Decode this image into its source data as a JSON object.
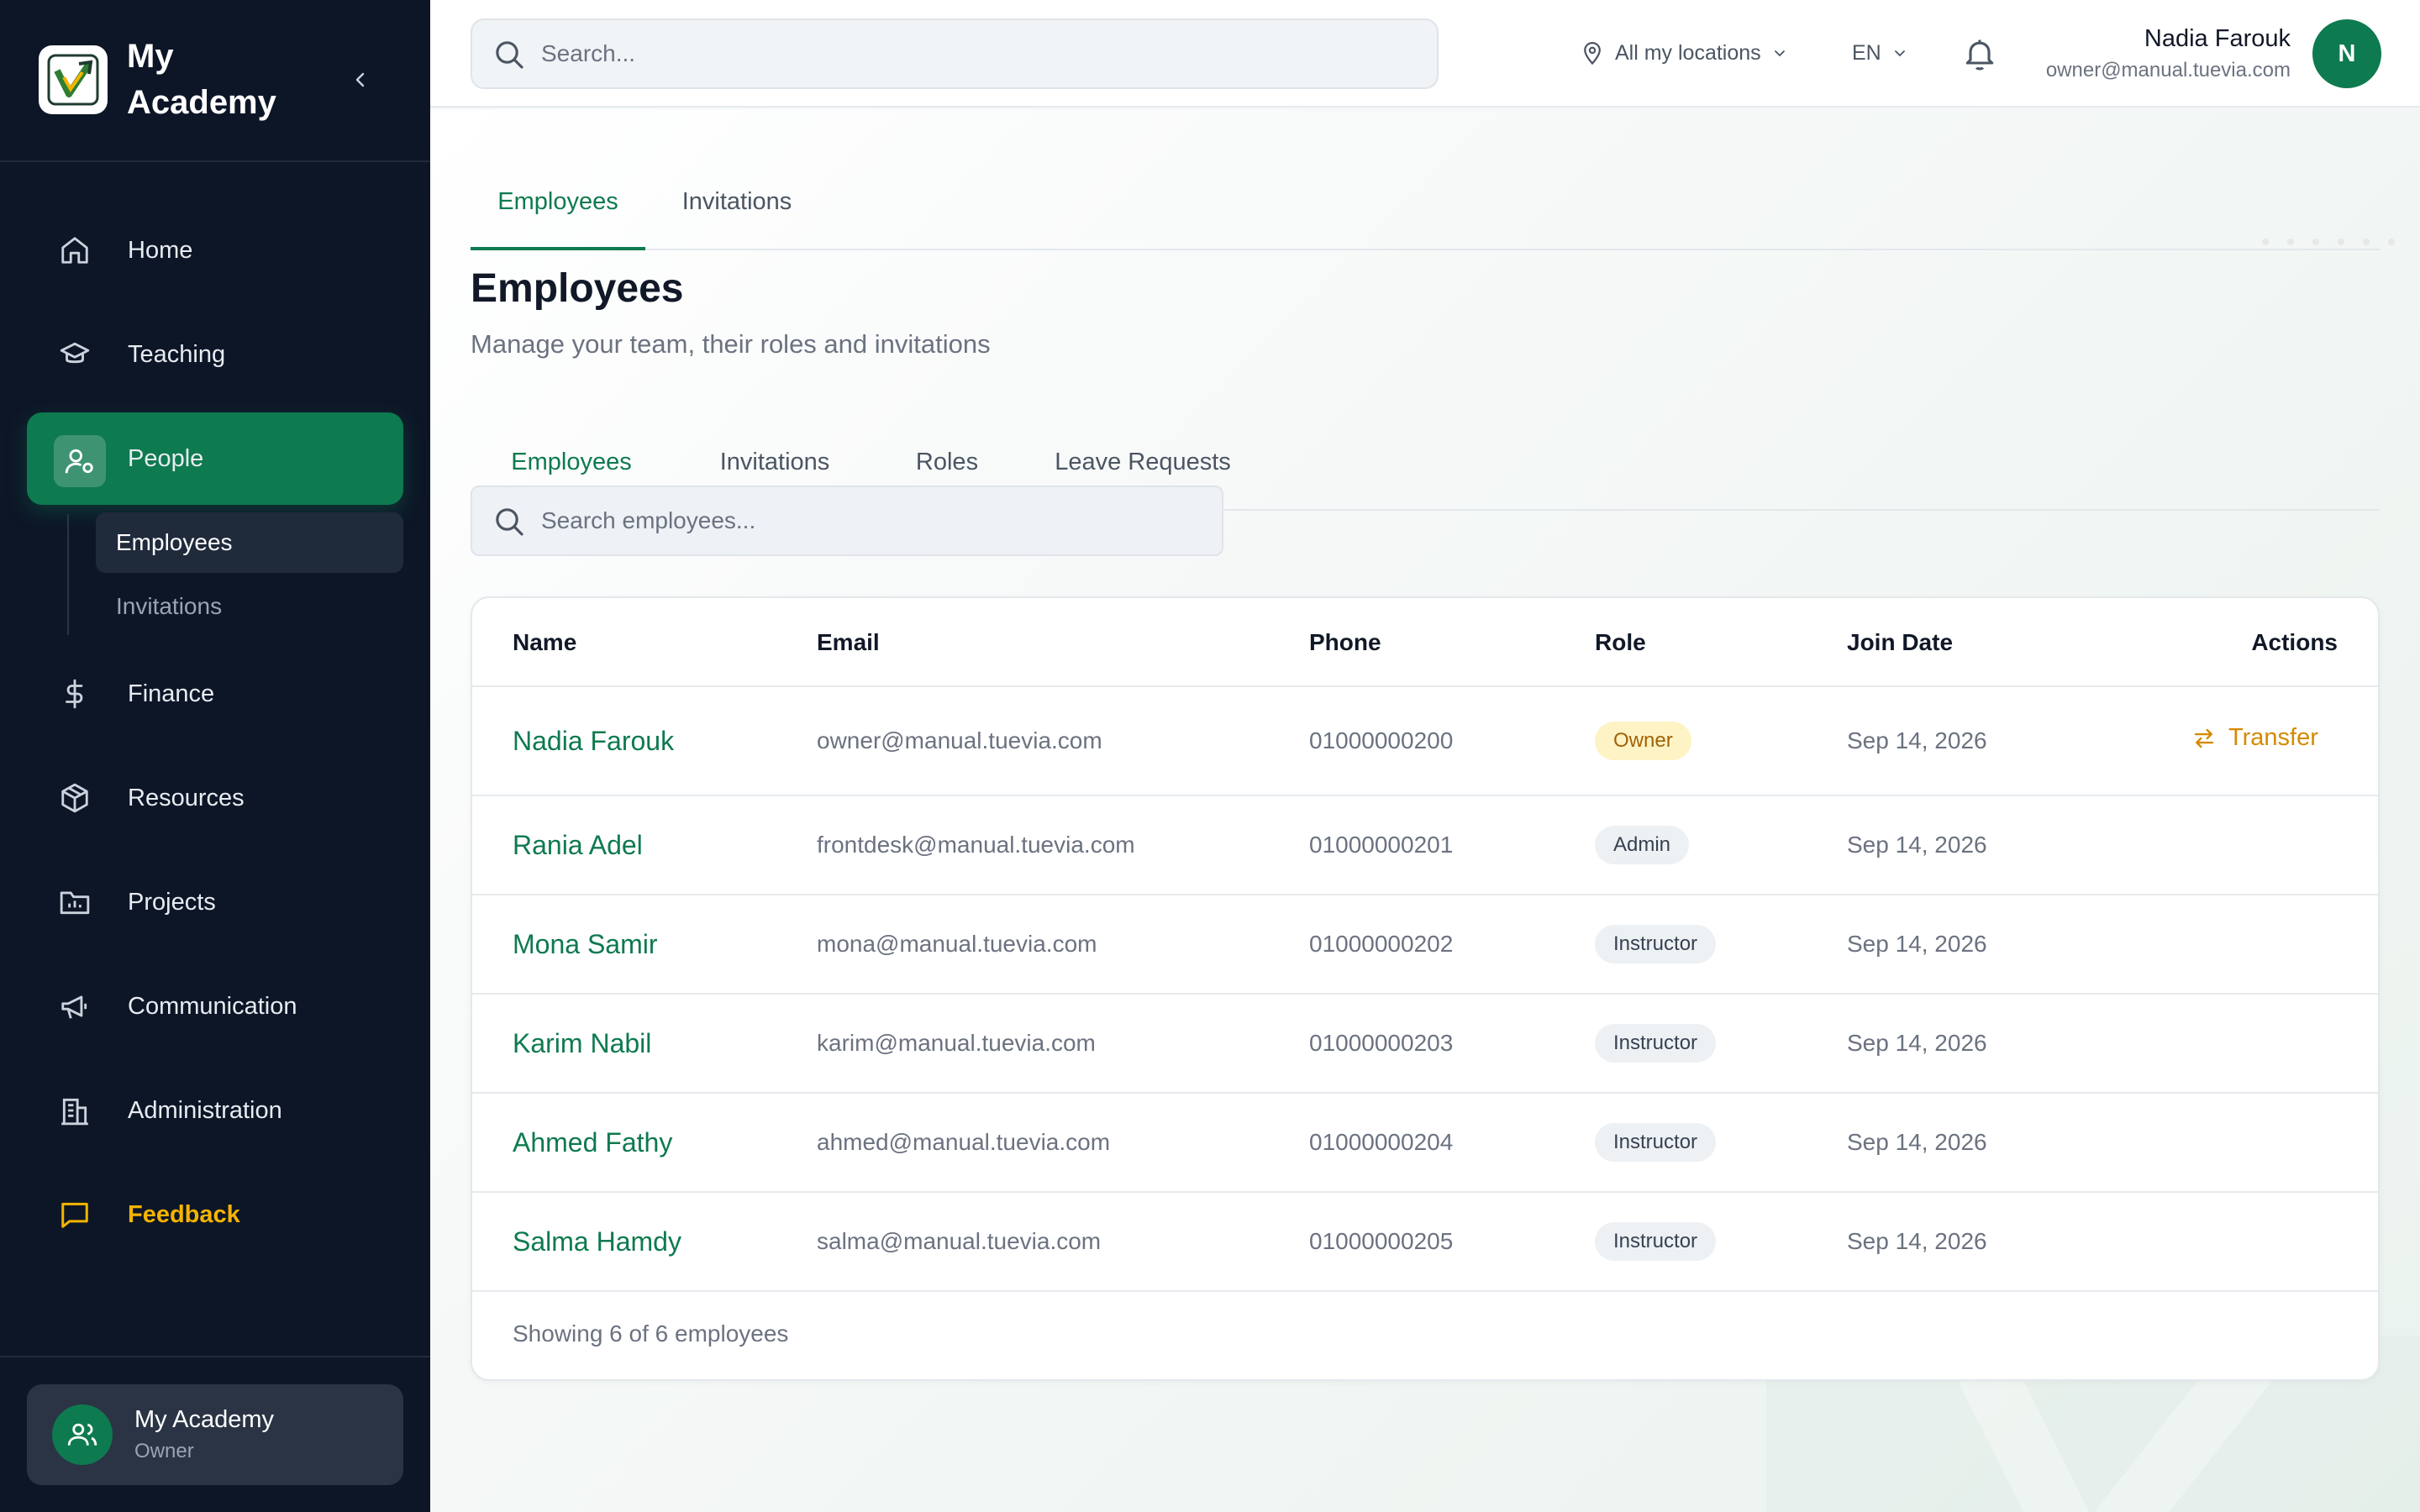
{
  "brand": {
    "title": "My Academy"
  },
  "sidebar": {
    "items": [
      {
        "label": "Home",
        "icon": "home-icon"
      },
      {
        "label": "Teaching",
        "icon": "graduation-cap-icon"
      },
      {
        "label": "People",
        "icon": "user-cog-icon",
        "active": true
      },
      {
        "label": "Finance",
        "icon": "dollar-icon"
      },
      {
        "label": "Resources",
        "icon": "package-icon"
      },
      {
        "label": "Projects",
        "icon": "folder-chart-icon"
      },
      {
        "label": "Communication",
        "icon": "megaphone-icon"
      },
      {
        "label": "Administration",
        "icon": "building-icon"
      },
      {
        "label": "Feedback",
        "icon": "message-square-icon"
      }
    ],
    "sub_items": [
      {
        "label": "Employees",
        "active": true
      },
      {
        "label": "Invitations"
      }
    ],
    "org": {
      "name": "My Academy",
      "role": "Owner"
    }
  },
  "topbar": {
    "search_placeholder": "Search...",
    "location": "All my locations",
    "language": "EN",
    "user": {
      "name": "Nadia Farouk",
      "email": "owner@manual.tuevia.com",
      "initial": "N"
    }
  },
  "main": {
    "top_tabs": [
      "Employees",
      "Invitations"
    ],
    "title": "Employees",
    "subtitle": "Manage your team, their roles and invitations",
    "inner_tabs": [
      "Employees",
      "Invitations",
      "Roles",
      "Leave Requests"
    ],
    "search_placeholder": "Search employees...",
    "table": {
      "columns": [
        "Name",
        "Email",
        "Phone",
        "Role",
        "Join Date",
        "Actions"
      ],
      "rows": [
        {
          "name": "Nadia Farouk",
          "email": "owner@manual.tuevia.com",
          "phone": "01000000200",
          "role": "Owner",
          "join_date": "Sep 14, 2026",
          "action": "Transfer"
        },
        {
          "name": "Rania Adel",
          "email": "frontdesk@manual.tuevia.com",
          "phone": "01000000201",
          "role": "Admin",
          "join_date": "Sep 14, 2026",
          "action": ""
        },
        {
          "name": "Mona Samir",
          "email": "mona@manual.tuevia.com",
          "phone": "01000000202",
          "role": "Instructor",
          "join_date": "Sep 14, 2026",
          "action": ""
        },
        {
          "name": "Karim Nabil",
          "email": "karim@manual.tuevia.com",
          "phone": "01000000203",
          "role": "Instructor",
          "join_date": "Sep 14, 2026",
          "action": ""
        },
        {
          "name": "Ahmed Fathy",
          "email": "ahmed@manual.tuevia.com",
          "phone": "01000000204",
          "role": "Instructor",
          "join_date": "Sep 14, 2026",
          "action": ""
        },
        {
          "name": "Salma Hamdy",
          "email": "salma@manual.tuevia.com",
          "phone": "01000000205",
          "role": "Instructor",
          "join_date": "Sep 14, 2026",
          "action": ""
        }
      ],
      "footer": "Showing 6 of 6 employees"
    }
  },
  "colors": {
    "accent": "#0e7a4f",
    "sidebar_bg": "#0d1627",
    "feedback": "#f5b400",
    "owner_badge": "#fdf3c4"
  }
}
